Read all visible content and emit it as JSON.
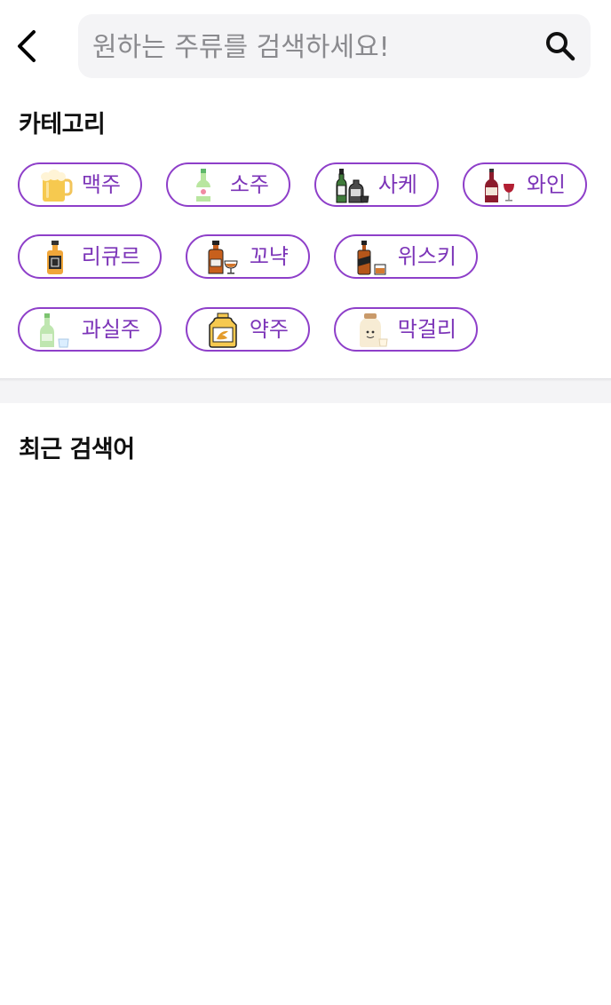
{
  "search": {
    "placeholder": "원하는 주류를 검색하세요!"
  },
  "categories_section": {
    "title": "카테고리"
  },
  "recent_section": {
    "title": "최근 검색어"
  },
  "categories": [
    {
      "label": "맥주",
      "icon": "beer-mug-icon"
    },
    {
      "label": "소주",
      "icon": "soju-bottle-icon"
    },
    {
      "label": "사케",
      "icon": "sake-bottle-icon"
    },
    {
      "label": "와인",
      "icon": "wine-bottle-icon"
    },
    {
      "label": "리큐르",
      "icon": "liqueur-bottle-icon"
    },
    {
      "label": "꼬냑",
      "icon": "cognac-bottle-icon"
    },
    {
      "label": "위스키",
      "icon": "whisky-bottle-icon"
    },
    {
      "label": "과실주",
      "icon": "fruit-wine-bottle-icon"
    },
    {
      "label": "약주",
      "icon": "yakju-jar-icon"
    },
    {
      "label": "막걸리",
      "icon": "makgeolli-bottle-icon"
    }
  ],
  "colors": {
    "accent": "#8e3fc9",
    "chip_text": "#7c34b8",
    "search_bg": "#f4f4f6"
  }
}
